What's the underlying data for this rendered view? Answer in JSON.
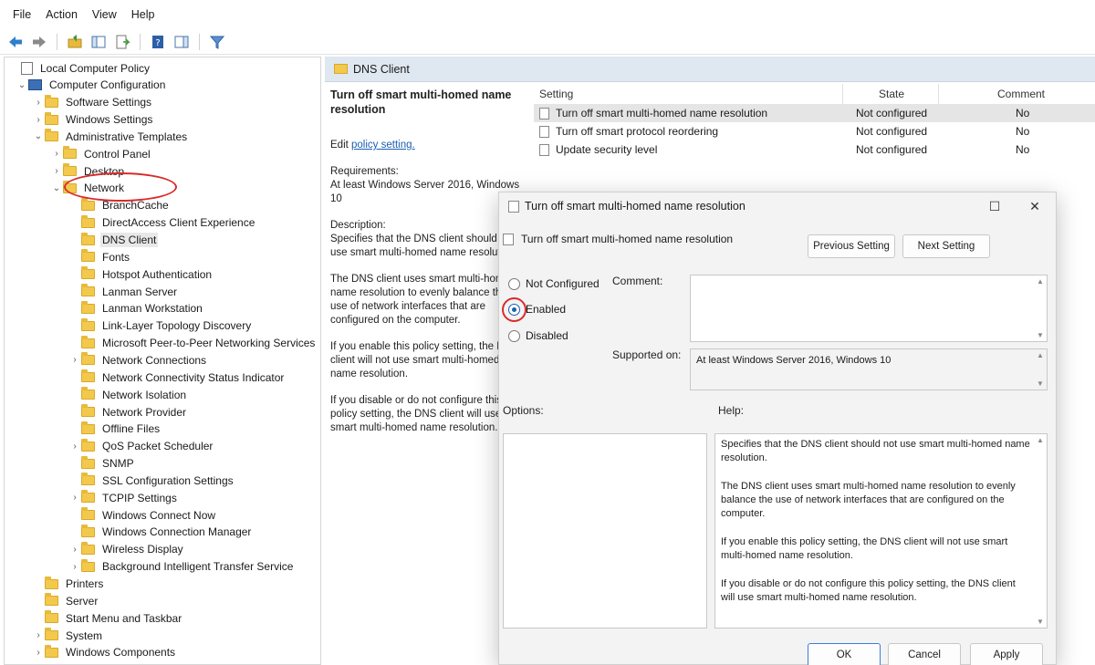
{
  "menu": [
    "File",
    "Action",
    "View",
    "Help"
  ],
  "toolbar": {
    "icons": [
      "back-arrow",
      "forward-arrow",
      "up-folder",
      "show-hide-tree",
      "export-list",
      "help",
      "show-hide-action-pane",
      "filter"
    ]
  },
  "tree": {
    "root": "Local Computer Policy",
    "computer_config": "Computer Configuration",
    "software_settings": "Software Settings",
    "windows_settings": "Windows Settings",
    "admin_templates": "Administrative Templates",
    "control_panel": "Control Panel",
    "desktop": "Desktop",
    "network": "Network",
    "network_children": [
      "BranchCache",
      "DirectAccess Client Experience",
      "DNS Client",
      "Fonts",
      "Hotspot Authentication",
      "Lanman Server",
      "Lanman Workstation",
      "Link-Layer Topology Discovery",
      "Microsoft Peer-to-Peer Networking Services",
      "Network Connections",
      "Network Connectivity Status Indicator",
      "Network Isolation",
      "Network Provider",
      "Offline Files",
      "QoS Packet Scheduler",
      "SNMP",
      "SSL Configuration Settings",
      "TCPIP Settings",
      "Windows Connect Now",
      "Windows Connection Manager",
      "Wireless Display",
      "Background Intelligent Transfer Service"
    ],
    "after_network": [
      "Printers",
      "Server",
      "Start Menu and Taskbar",
      "System",
      "Windows Components"
    ]
  },
  "pane": {
    "header": "DNS Client",
    "policy_title": "Turn off smart multi-homed name resolution",
    "edit_prefix": "Edit ",
    "edit_link": "policy setting.",
    "requirements": "Requirements:\nAt least Windows Server 2016, Windows 10",
    "description": "Description:\nSpecifies that the DNS client should not use smart multi-homed name resolution.",
    "desc2": "The DNS client uses smart multi-homed name resolution to evenly balance the use of network interfaces that are configured on the computer.",
    "desc3": "If you enable this policy setting, the DNS client will not use smart multi-homed name resolution.",
    "desc4": "If you disable or do not configure this policy setting, the DNS client will use smart multi-homed name resolution."
  },
  "settings": {
    "headers": {
      "setting": "Setting",
      "state": "State",
      "comment": "Comment"
    },
    "rows": [
      {
        "name": "Turn off smart multi-homed name resolution",
        "state": "Not configured",
        "comment": "No"
      },
      {
        "name": "Turn off smart protocol reordering",
        "state": "Not configured",
        "comment": "No"
      },
      {
        "name": "Update security level",
        "state": "Not configured",
        "comment": "No"
      }
    ]
  },
  "dialog": {
    "title": "Turn off smart multi-homed name resolution",
    "subtitle": "Turn off smart multi-homed name resolution",
    "prev_btn": "Previous Setting",
    "next_btn": "Next Setting",
    "radio_not_configured": "Not Configured",
    "radio_enabled": "Enabled",
    "radio_disabled": "Disabled",
    "selected": "Enabled",
    "comment_label": "Comment:",
    "supported_label": "Supported on:",
    "supported_value": "At least Windows Server 2016, Windows 10",
    "options_label": "Options:",
    "help_label": "Help:",
    "help_p1": "Specifies that the DNS client should not use smart multi-homed name resolution.",
    "help_p2": "The DNS client uses smart multi-homed name resolution to evenly balance the use of network interfaces that are configured on the computer.",
    "help_p3": "If you enable this policy setting, the DNS client will not use smart multi-homed name resolution.",
    "help_p4": "If you disable or do not configure this policy setting, the DNS client will use smart multi-homed name resolution.",
    "ok": "OK",
    "cancel": "Cancel",
    "apply": "Apply"
  }
}
